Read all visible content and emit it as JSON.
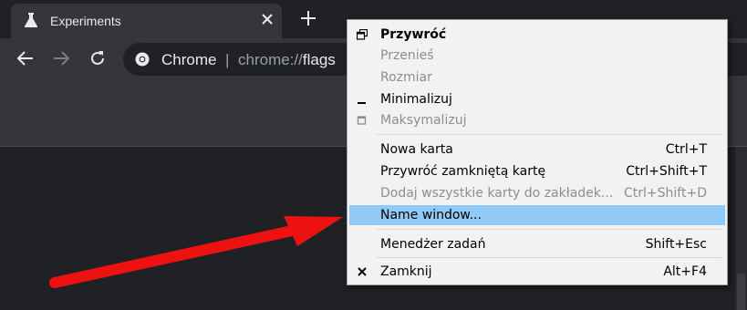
{
  "browser": {
    "tab": {
      "title": "Experiments",
      "icon": "flask-icon"
    },
    "omnibox": {
      "site_label": "Chrome",
      "divider": "|",
      "url_prefix": "chrome://",
      "url_host": "flags"
    }
  },
  "context_menu": {
    "window_items": [
      {
        "label": "Przywróć",
        "icon": "restore-icon",
        "state": "bold"
      },
      {
        "label": "Przenieś",
        "state": "disabled"
      },
      {
        "label": "Rozmiar",
        "state": "disabled"
      },
      {
        "label": "Minimalizuj",
        "icon": "minimize-icon",
        "state": "normal"
      },
      {
        "label": "Maksymalizuj",
        "icon": "maximize-icon",
        "state": "disabled"
      }
    ],
    "tab_items": [
      {
        "label": "Nowa karta",
        "shortcut": "Ctrl+T",
        "state": "normal"
      },
      {
        "label": "Przywróć zamkniętą kartę",
        "shortcut": "Ctrl+Shift+T",
        "state": "normal"
      },
      {
        "label": "Dodaj wszystkie karty do zakładek...",
        "shortcut": "Ctrl+Shift+D",
        "state": "disabled"
      },
      {
        "label": "Name window...",
        "state": "highlighted"
      }
    ],
    "task_manager": {
      "label": "Menedżer zadań",
      "shortcut": "Shift+Esc"
    },
    "close": {
      "label": "Zamknij",
      "shortcut": "Alt+F4",
      "icon": "close-x-icon"
    }
  },
  "annotation": {
    "color": "#ee1111",
    "points_to": "Name window..."
  },
  "colors": {
    "highlight": "#91c9f7",
    "menu_bg": "#f2f2f2",
    "disabled_text": "#8d8d8d"
  }
}
